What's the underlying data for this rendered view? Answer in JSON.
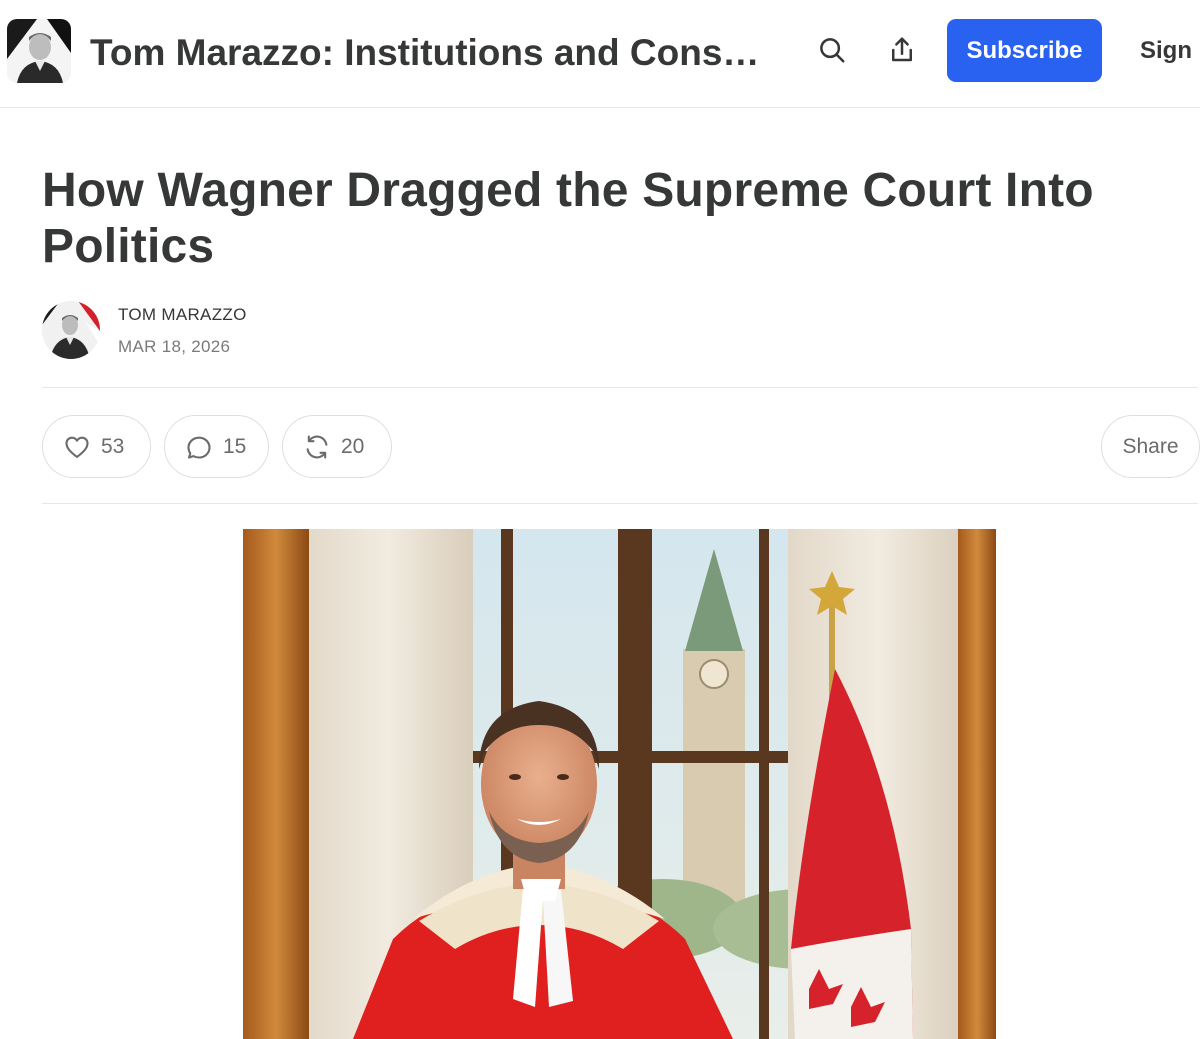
{
  "header": {
    "publication_title": "Tom Marazzo: Institutions and Cons…",
    "subscribe_label": "Subscribe",
    "signin_label": "Sign i",
    "search_icon": "search-icon",
    "share_icon": "share-upload-icon",
    "accent_color": "#2962f0"
  },
  "post": {
    "title": "How Wagner Dragged the Supreme Court Into Politics",
    "author": "TOM MARAZZO",
    "date": "MAR 18, 2026"
  },
  "actions": {
    "likes": "53",
    "comments": "15",
    "restacks": "20",
    "share_label": "Share"
  },
  "hero_image": {
    "subject": "portrait-photo"
  }
}
